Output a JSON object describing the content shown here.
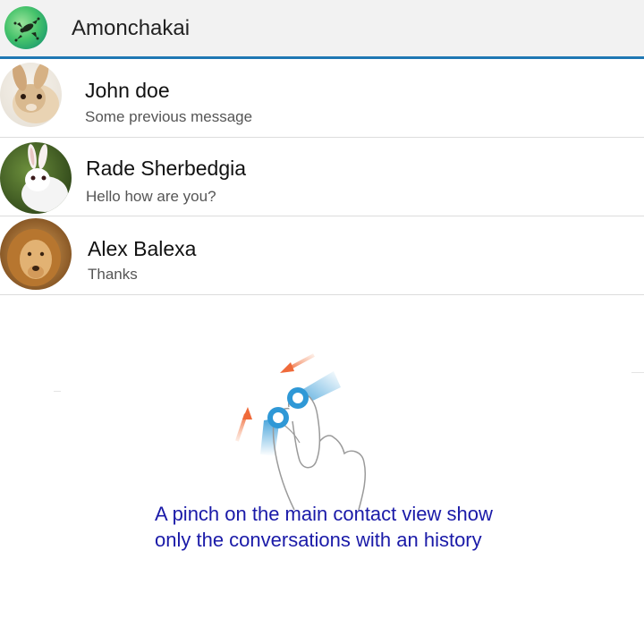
{
  "header": {
    "title": "Amonchakai",
    "avatar_icon": "green-frog-avatar",
    "accent_color": "#1f78b4"
  },
  "contacts": [
    {
      "name": "John doe",
      "message": "Some previous message",
      "avatar": "rabbit-avatar"
    },
    {
      "name": "Rade Sherbedgia",
      "message": "Hello how are you?",
      "avatar": "white-rabbit-avatar"
    },
    {
      "name": "Alex Balexa",
      "message": "Thanks",
      "avatar": "lion-avatar"
    }
  ],
  "hint": {
    "icon": "pinch-gesture-icon",
    "line1": "A pinch on the main contact view show",
    "line2": "only the conversations with an history",
    "color": "#1a1aa8"
  }
}
